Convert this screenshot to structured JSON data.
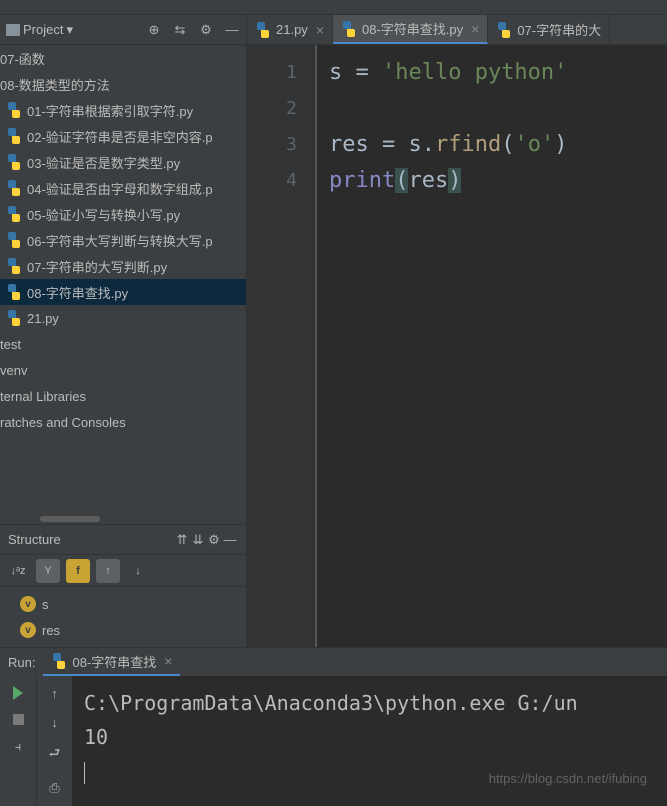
{
  "project_panel": {
    "label": "Project",
    "files": [
      {
        "name": "07-函数",
        "type": "folder"
      },
      {
        "name": "08-数据类型的方法",
        "type": "folder"
      },
      {
        "name": "01-字符串根据索引取字符.py",
        "type": "py"
      },
      {
        "name": "02-验证字符串是否是非空内容.p",
        "type": "py"
      },
      {
        "name": "03-验证是否是数字类型.py",
        "type": "py"
      },
      {
        "name": "04-验证是否由字母和数字组成.p",
        "type": "py"
      },
      {
        "name": "05-验证小写与转换小写.py",
        "type": "py"
      },
      {
        "name": "06-字符串大写判断与转换大写.p",
        "type": "py"
      },
      {
        "name": "07-字符串的大写判断.py",
        "type": "py"
      },
      {
        "name": "08-字符串查找.py",
        "type": "py",
        "selected": true
      },
      {
        "name": "21.py",
        "type": "py"
      },
      {
        "name": "test",
        "type": "folder"
      },
      {
        "name": "venv",
        "type": "folder"
      },
      {
        "name": "ternal Libraries",
        "type": "text"
      },
      {
        "name": "ratches and Consoles",
        "type": "text"
      }
    ]
  },
  "structure": {
    "label": "Structure",
    "toolbar": [
      "↓ᵃz",
      "Y",
      "f",
      "↑",
      "↓"
    ],
    "items": [
      {
        "icon": "v",
        "name": "s"
      },
      {
        "icon": "v",
        "name": "res"
      }
    ]
  },
  "tabs": [
    {
      "label": "21.py",
      "active": false
    },
    {
      "label": "08-字符串查找.py",
      "active": true
    },
    {
      "label": "07-字符串的大",
      "active": false
    }
  ],
  "editor": {
    "line_numbers": [
      "1",
      "2",
      "3",
      "4"
    ],
    "code_lines": [
      [
        {
          "t": "s = ",
          "c": ""
        },
        {
          "t": "'hello python'",
          "c": "str"
        }
      ],
      [],
      [
        {
          "t": "res = s.",
          "c": ""
        },
        {
          "t": "rfind",
          "c": "fn"
        },
        {
          "t": "(",
          "c": ""
        },
        {
          "t": "'o'",
          "c": "str"
        },
        {
          "t": ")",
          "c": ""
        }
      ],
      [
        {
          "t": "print",
          "c": "builtin"
        },
        {
          "t": "(",
          "c": "paren-hl"
        },
        {
          "t": "res",
          "c": ""
        },
        {
          "t": ")",
          "c": "paren-hl"
        }
      ]
    ]
  },
  "run": {
    "label": "Run:",
    "tab": "08-字符串查找",
    "output": [
      "C:\\ProgramData\\Anaconda3\\python.exe G:/un",
      "10"
    ]
  },
  "watermark": "https://blog.csdn.net/ifubing"
}
